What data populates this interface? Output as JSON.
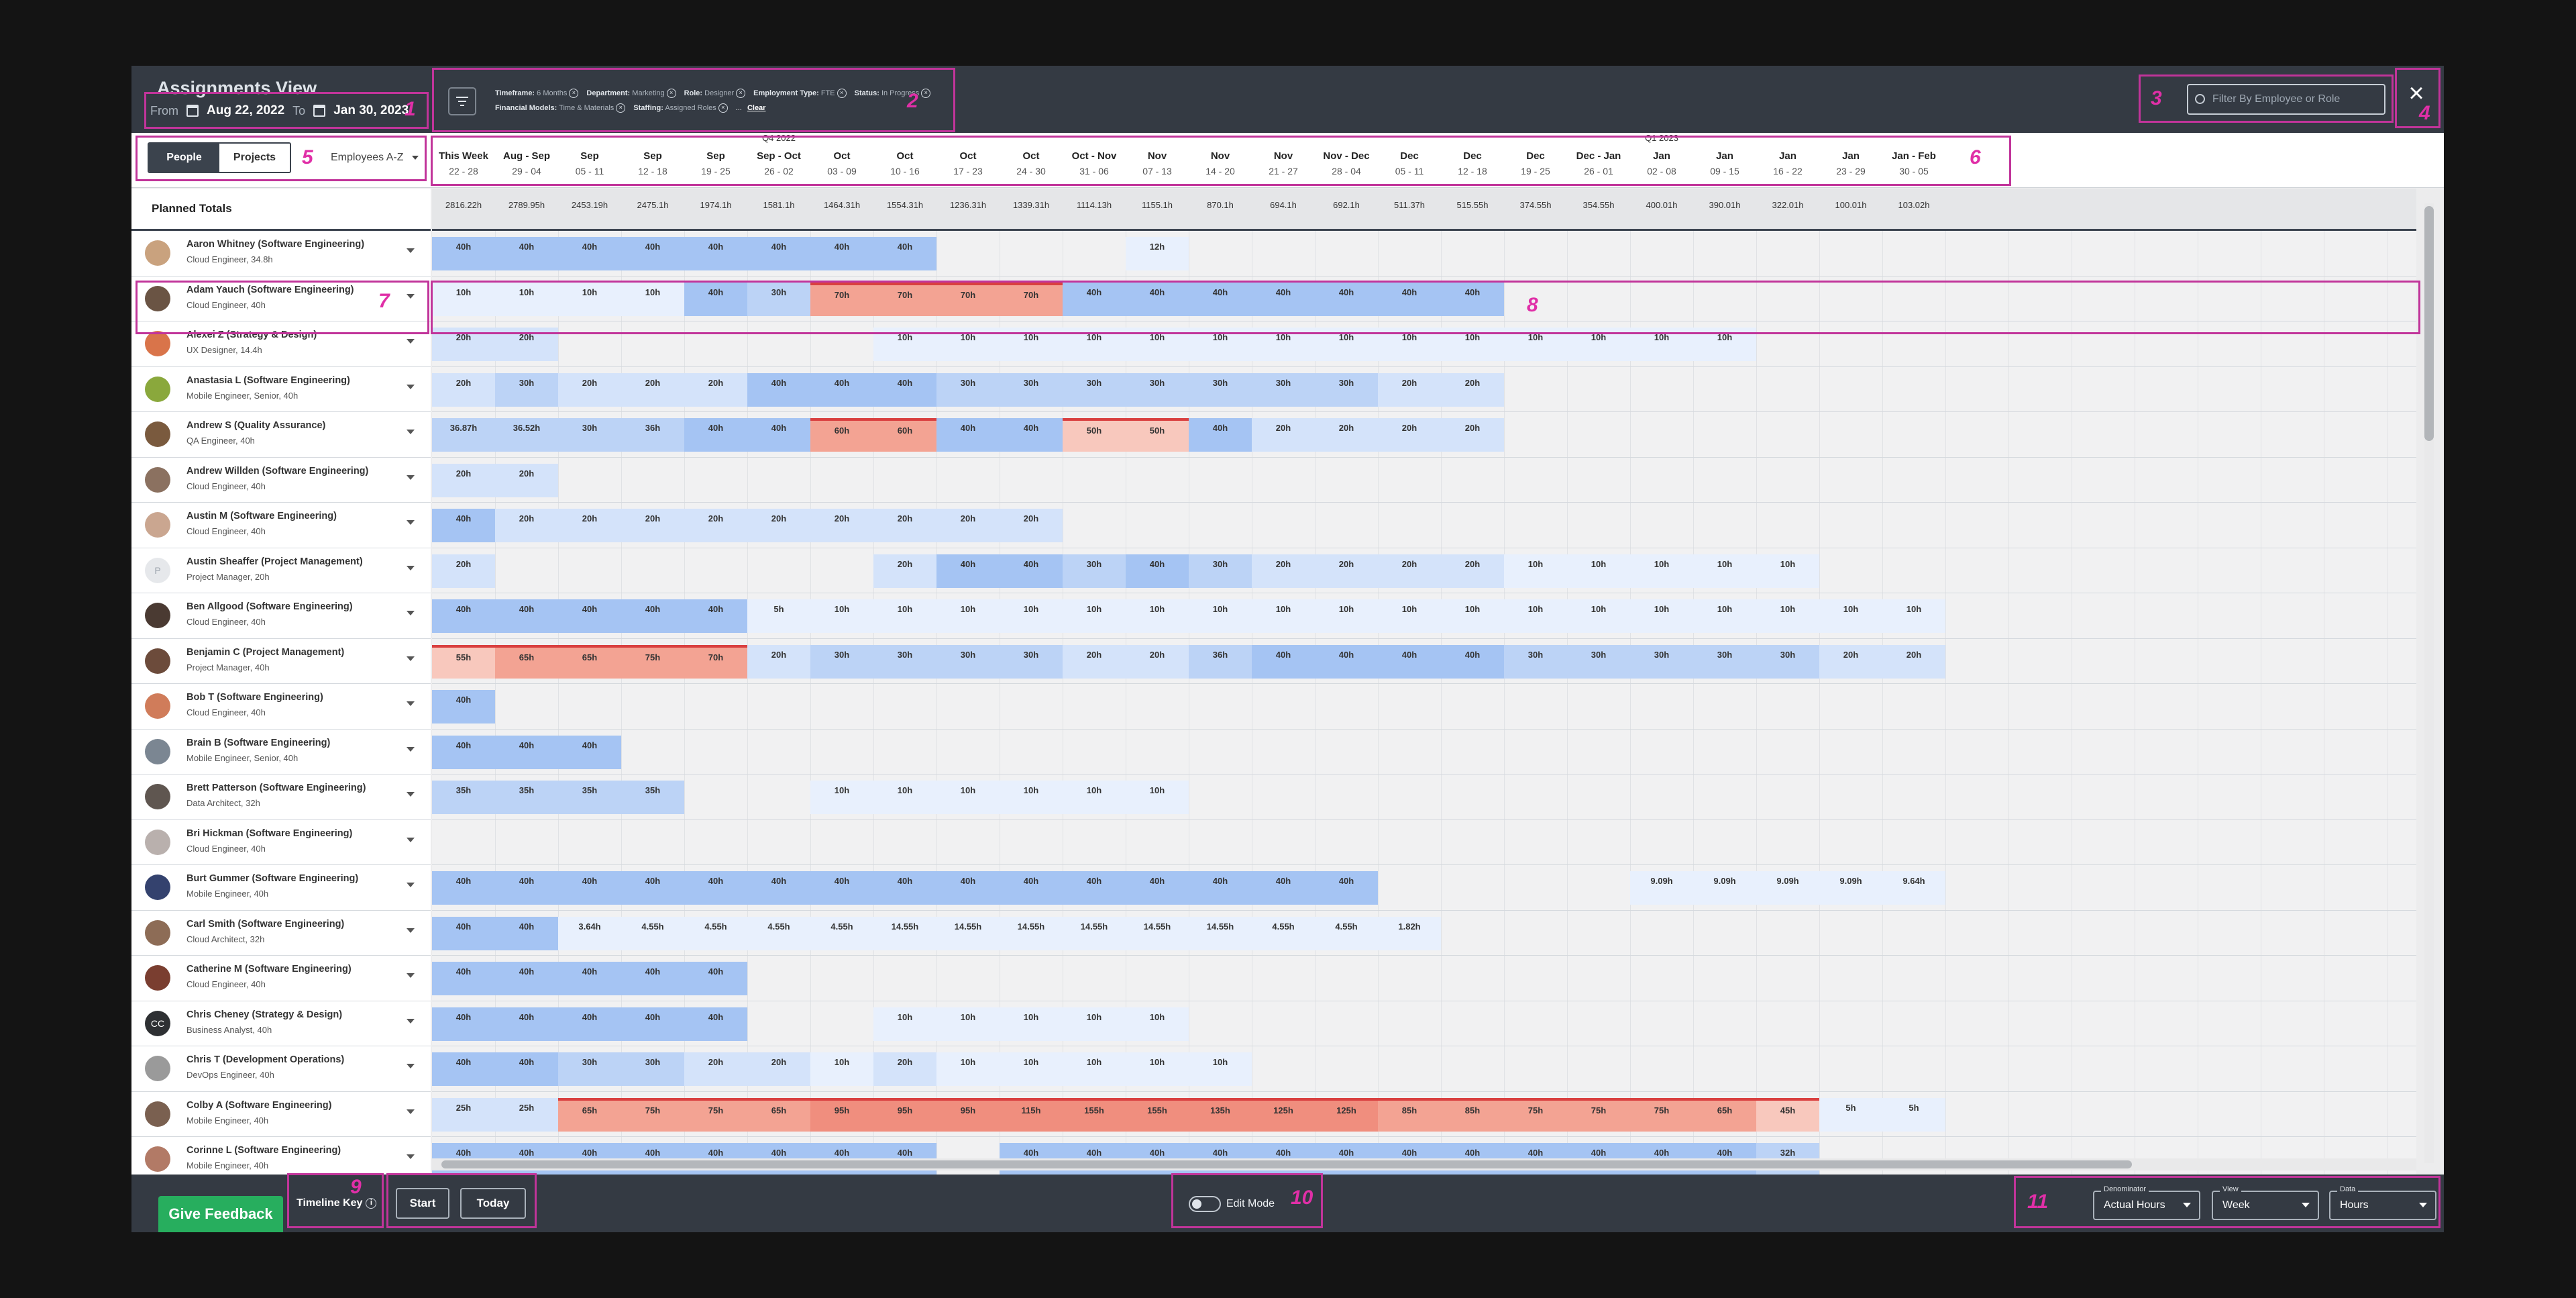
{
  "app": {
    "title": "Assignments View"
  },
  "timeframe": {
    "from_label": "From",
    "from": "Aug 22, 2022",
    "to_label": "To",
    "to": "Jan 30, 2023"
  },
  "filters": {
    "chips": [
      {
        "label": "Timeframe:",
        "value": "6 Months"
      },
      {
        "label": "Department:",
        "value": "Marketing"
      },
      {
        "label": "Role:",
        "value": "Designer"
      },
      {
        "label": "Employment Type:",
        "value": "FTE"
      },
      {
        "label": "Status:",
        "value": "In Progress"
      },
      {
        "label": "Financial Models:",
        "value": "Time & Materials"
      },
      {
        "label": "Staffing:",
        "value": "Assigned Roles"
      }
    ],
    "more": "...",
    "clear_label": "Clear"
  },
  "search": {
    "placeholder": "Filter By Employee or Role"
  },
  "view_toggle": {
    "people": "People",
    "projects": "Projects"
  },
  "sort": {
    "label": "Employees A-Z"
  },
  "columns": [
    {
      "q": "",
      "m": "This Week",
      "d": "22 - 28"
    },
    {
      "q": "",
      "m": "Aug - Sep",
      "d": "29 - 04"
    },
    {
      "q": "",
      "m": "Sep",
      "d": "05 - 11"
    },
    {
      "q": "",
      "m": "Sep",
      "d": "12 - 18"
    },
    {
      "q": "",
      "m": "Sep",
      "d": "19 - 25"
    },
    {
      "q": "Q4 2022",
      "m": "Sep - Oct",
      "d": "26 - 02"
    },
    {
      "q": "",
      "m": "Oct",
      "d": "03 - 09"
    },
    {
      "q": "",
      "m": "Oct",
      "d": "10 - 16"
    },
    {
      "q": "",
      "m": "Oct",
      "d": "17 - 23"
    },
    {
      "q": "",
      "m": "Oct",
      "d": "24 - 30"
    },
    {
      "q": "",
      "m": "Oct - Nov",
      "d": "31 - 06"
    },
    {
      "q": "",
      "m": "Nov",
      "d": "07 - 13"
    },
    {
      "q": "",
      "m": "Nov",
      "d": "14 - 20"
    },
    {
      "q": "",
      "m": "Nov",
      "d": "21 - 27"
    },
    {
      "q": "",
      "m": "Nov - Dec",
      "d": "28 - 04"
    },
    {
      "q": "",
      "m": "Dec",
      "d": "05 - 11"
    },
    {
      "q": "",
      "m": "Dec",
      "d": "12 - 18"
    },
    {
      "q": "",
      "m": "Dec",
      "d": "19 - 25"
    },
    {
      "q": "",
      "m": "Dec - Jan",
      "d": "26 - 01"
    },
    {
      "q": "Q1 2023",
      "m": "Jan",
      "d": "02 - 08"
    },
    {
      "q": "",
      "m": "Jan",
      "d": "09 - 15"
    },
    {
      "q": "",
      "m": "Jan",
      "d": "16 - 22"
    },
    {
      "q": "",
      "m": "Jan",
      "d": "23 - 29"
    },
    {
      "q": "",
      "m": "Jan - Feb",
      "d": "30 - 05"
    }
  ],
  "totals": {
    "label": "Planned Totals",
    "values": [
      "2816.22h",
      "2789.95h",
      "2453.19h",
      "2475.1h",
      "1974.1h",
      "1581.1h",
      "1464.31h",
      "1554.31h",
      "1236.31h",
      "1339.31h",
      "1114.13h",
      "1155.1h",
      "870.1h",
      "694.1h",
      "692.1h",
      "511.37h",
      "515.55h",
      "374.55h",
      "354.55h",
      "400.01h",
      "390.01h",
      "322.01h",
      "100.01h",
      "103.02h"
    ]
  },
  "people": [
    {
      "name": "Aaron Whitney (Software Engineering)",
      "role": "Cloud Engineer, 34.8h",
      "avatar": "#c9a27e",
      "hours": [
        "40h",
        "40h",
        "40h",
        "40h",
        "40h",
        "40h",
        "40h",
        "40h",
        "",
        "",
        "",
        "12h",
        "",
        "",
        "",
        "",
        "",
        "",
        "",
        "",
        "",
        "",
        "",
        ""
      ]
    },
    {
      "name": "Adam Yauch (Software Engineering)",
      "role": "Cloud Engineer, 40h",
      "avatar": "#6a5444",
      "hours": [
        "10h",
        "10h",
        "10h",
        "10h",
        "40h",
        "30h",
        "70h",
        "70h",
        "70h",
        "70h",
        "40h",
        "40h",
        "40h",
        "40h",
        "40h",
        "40h",
        "40h",
        "",
        "",
        "",
        "",
        "",
        "",
        ""
      ]
    },
    {
      "name": "Alexei Z (Strategy & Design)",
      "role": "UX Designer, 14.4h",
      "avatar": "#d9744a",
      "hours": [
        "20h",
        "20h",
        "",
        "",
        "",
        "",
        "",
        "10h",
        "10h",
        "10h",
        "10h",
        "10h",
        "10h",
        "10h",
        "10h",
        "10h",
        "10h",
        "10h",
        "10h",
        "10h",
        "10h",
        "",
        "",
        ""
      ]
    },
    {
      "name": "Anastasia L (Software Engineering)",
      "role": "Mobile Engineer, Senior, 40h",
      "avatar": "#8aa83c",
      "hours": [
        "20h",
        "30h",
        "20h",
        "20h",
        "20h",
        "40h",
        "40h",
        "40h",
        "30h",
        "30h",
        "30h",
        "30h",
        "30h",
        "30h",
        "30h",
        "20h",
        "20h",
        "",
        "",
        "",
        "",
        "",
        "",
        ""
      ]
    },
    {
      "name": "Andrew S (Quality Assurance)",
      "role": "QA Engineer, 40h",
      "avatar": "#7a5a3e",
      "hours": [
        "36.87h",
        "36.52h",
        "30h",
        "36h",
        "40h",
        "40h",
        "60h",
        "60h",
        "40h",
        "40h",
        "50h",
        "50h",
        "40h",
        "20h",
        "20h",
        "20h",
        "20h",
        "",
        "",
        "",
        "",
        "",
        "",
        ""
      ]
    },
    {
      "name": "Andrew Willden (Software Engineering)",
      "role": "Cloud Engineer, 40h",
      "avatar": "#8b7160",
      "hours": [
        "20h",
        "20h",
        "",
        "",
        "",
        "",
        "",
        "",
        "",
        "",
        "",
        "",
        "",
        "",
        "",
        "",
        "",
        "",
        "",
        "",
        "",
        "",
        "",
        ""
      ]
    },
    {
      "name": "Austin M (Software Engineering)",
      "role": "Cloud Engineer, 40h",
      "avatar": "#caa690",
      "hours": [
        "40h",
        "20h",
        "20h",
        "20h",
        "20h",
        "20h",
        "20h",
        "20h",
        "20h",
        "20h",
        "",
        "",
        "",
        "",
        "",
        "",
        "",
        "",
        "",
        "",
        "",
        "",
        "",
        ""
      ]
    },
    {
      "name": "Austin Sheaffer (Project Management)",
      "role": "Project Manager, 20h",
      "avatar": "#e6e8eb",
      "initial": "P",
      "hours": [
        "20h",
        "",
        "",
        "",
        "",
        "",
        "",
        "20h",
        "40h",
        "40h",
        "30h",
        "40h",
        "30h",
        "20h",
        "20h",
        "20h",
        "20h",
        "10h",
        "10h",
        "10h",
        "10h",
        "10h",
        "",
        ""
      ]
    },
    {
      "name": "Ben Allgood (Software Engineering)",
      "role": "Cloud Engineer, 40h",
      "avatar": "#4a3a32",
      "hours": [
        "40h",
        "40h",
        "40h",
        "40h",
        "40h",
        "5h",
        "10h",
        "10h",
        "10h",
        "10h",
        "10h",
        "10h",
        "10h",
        "10h",
        "10h",
        "10h",
        "10h",
        "10h",
        "10h",
        "10h",
        "10h",
        "10h",
        "10h",
        "10h"
      ]
    },
    {
      "name": "Benjamin C (Project Management)",
      "role": "Project Manager, 40h",
      "avatar": "#6c4b3b",
      "hours": [
        "55h",
        "65h",
        "65h",
        "75h",
        "70h",
        "20h",
        "30h",
        "30h",
        "30h",
        "30h",
        "20h",
        "20h",
        "36h",
        "40h",
        "40h",
        "40h",
        "40h",
        "30h",
        "30h",
        "30h",
        "30h",
        "30h",
        "20h",
        "20h"
      ]
    },
    {
      "name": "Bob T (Software Engineering)",
      "role": "Cloud Engineer, 40h",
      "avatar": "#d07c5a",
      "hours": [
        "40h",
        "",
        "",
        "",
        "",
        "",
        "",
        "",
        "",
        "",
        "",
        "",
        "",
        "",
        "",
        "",
        "",
        "",
        "",
        "",
        "",
        "",
        "",
        ""
      ]
    },
    {
      "name": "Brain B (Software Engineering)",
      "role": "Mobile Engineer, Senior, 40h",
      "avatar": "#7b8692",
      "hours": [
        "40h",
        "40h",
        "40h",
        "",
        "",
        "",
        "",
        "",
        "",
        "",
        "",
        "",
        "",
        "",
        "",
        "",
        "",
        "",
        "",
        "",
        "",
        "",
        "",
        ""
      ]
    },
    {
      "name": "Brett Patterson (Software Engineering)",
      "role": "Data Architect, 32h",
      "avatar": "#5f5650",
      "hours": [
        "35h",
        "35h",
        "35h",
        "35h",
        "",
        "",
        "10h",
        "10h",
        "10h",
        "10h",
        "10h",
        "10h",
        "",
        "",
        "",
        "",
        "",
        "",
        "",
        "",
        "",
        "",
        "",
        ""
      ]
    },
    {
      "name": "Bri Hickman (Software Engineering)",
      "role": "Cloud Engineer, 40h",
      "avatar": "#b9b0ad",
      "hours": [
        "",
        "",
        "",
        "",
        "",
        "",
        "",
        "",
        "",
        "",
        "",
        "",
        "",
        "",
        "",
        "",
        "",
        "",
        "",
        "",
        "",
        "",
        "",
        ""
      ]
    },
    {
      "name": "Burt Gummer (Software Engineering)",
      "role": "Mobile Engineer, 40h",
      "avatar": "#34426e",
      "hours": [
        "40h",
        "40h",
        "40h",
        "40h",
        "40h",
        "40h",
        "40h",
        "40h",
        "40h",
        "40h",
        "40h",
        "40h",
        "40h",
        "40h",
        "40h",
        "",
        "",
        "",
        "",
        "9.09h",
        "9.09h",
        "9.09h",
        "9.09h",
        "9.64h"
      ]
    },
    {
      "name": "Carl Smith (Software Engineering)",
      "role": "Cloud Architect, 32h",
      "avatar": "#8d6c56",
      "hours": [
        "40h",
        "40h",
        "3.64h",
        "4.55h",
        "4.55h",
        "4.55h",
        "4.55h",
        "14.55h",
        "14.55h",
        "14.55h",
        "14.55h",
        "14.55h",
        "14.55h",
        "4.55h",
        "4.55h",
        "1.82h",
        "",
        "",
        "",
        "",
        "",
        "",
        "",
        ""
      ]
    },
    {
      "name": "Catherine M (Software Engineering)",
      "role": "Cloud Engineer, 40h",
      "avatar": "#7a3e30",
      "hours": [
        "40h",
        "40h",
        "40h",
        "40h",
        "40h",
        "",
        "",
        "",
        "",
        "",
        "",
        "",
        "",
        "",
        "",
        "",
        "",
        "",
        "",
        "",
        "",
        "",
        "",
        ""
      ]
    },
    {
      "name": "Chris Cheney (Strategy & Design)",
      "role": "Business Analyst, 40h",
      "avatar": "#2e3033",
      "initial": "CC",
      "hours": [
        "40h",
        "40h",
        "40h",
        "40h",
        "40h",
        "",
        "",
        "10h",
        "10h",
        "10h",
        "10h",
        "10h",
        "",
        "",
        "",
        "",
        "",
        "",
        "",
        "",
        "",
        "",
        "",
        ""
      ]
    },
    {
      "name": "Chris T (Development Operations)",
      "role": "DevOps Engineer, 40h",
      "avatar": "#9a9a9a",
      "hours": [
        "40h",
        "40h",
        "30h",
        "30h",
        "20h",
        "20h",
        "10h",
        "20h",
        "10h",
        "10h",
        "10h",
        "10h",
        "10h",
        "",
        "",
        "",
        "",
        "",
        "",
        "",
        "",
        "",
        "",
        ""
      ]
    },
    {
      "name": "Colby A (Software Engineering)",
      "role": "Mobile Engineer, 40h",
      "avatar": "#7a6050",
      "hours": [
        "25h",
        "25h",
        "65h",
        "75h",
        "75h",
        "65h",
        "95h",
        "95h",
        "95h",
        "115h",
        "155h",
        "155h",
        "135h",
        "125h",
        "125h",
        "85h",
        "85h",
        "75h",
        "75h",
        "75h",
        "65h",
        "45h",
        "5h",
        "5h"
      ]
    },
    {
      "name": "Corinne L (Software Engineering)",
      "role": "Mobile Engineer, 40h",
      "avatar": "#b27a66",
      "hours": [
        "40h",
        "40h",
        "40h",
        "40h",
        "40h",
        "40h",
        "40h",
        "40h",
        "",
        "40h",
        "40h",
        "40h",
        "40h",
        "40h",
        "40h",
        "40h",
        "40h",
        "40h",
        "40h",
        "40h",
        "40h",
        "32h",
        "",
        ""
      ]
    }
  ],
  "footer": {
    "feedback": "Give Feedback",
    "timeline_key": "Timeline Key",
    "start": "Start",
    "today": "Today",
    "edit_mode": "Edit Mode",
    "denominator": {
      "label": "Denominator",
      "value": "Actual Hours"
    },
    "view": {
      "label": "View",
      "value": "Week"
    },
    "data": {
      "label": "Data",
      "value": "Hours"
    }
  },
  "annotations": [
    "1",
    "2",
    "3",
    "4",
    "5",
    "6",
    "7",
    "8",
    "9",
    "10",
    "11"
  ],
  "colors": {
    "header": "#343a43",
    "accent_pink": "#c1349a",
    "feedback_green": "#27ae5e",
    "over_red": "#d9534f"
  }
}
